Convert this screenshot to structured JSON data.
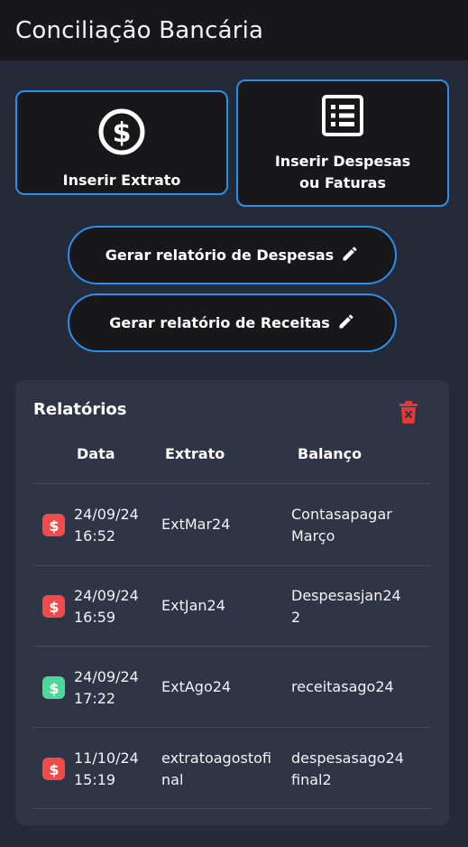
{
  "header": {
    "title": "Conciliação Bancária"
  },
  "actions": {
    "extrato_label": "Inserir Extrato",
    "despesas_label": "Inserir Despesas\nou Faturas",
    "relatorio_despesas_label": "Gerar relatório de Despesas",
    "relatorio_receitas_label": "Gerar relatório de Receitas"
  },
  "reports": {
    "title": "Relatórios",
    "columns": {
      "data": "Data",
      "extrato": "Extrato",
      "balanco": "Balanço"
    },
    "rows": [
      {
        "status": "expense",
        "status_color": "#f04a4a",
        "date": "24/09/24\n16:52",
        "extrato": "ExtMar24",
        "balanco": "Contasapagar\nMarço"
      },
      {
        "status": "expense",
        "status_color": "#f04a4a",
        "date": "24/09/24\n16:59",
        "extrato": "ExtJan24",
        "balanco": "Despesasjan24\n2"
      },
      {
        "status": "income",
        "status_color": "#4ed79a",
        "date": "24/09/24\n17:22",
        "extrato": "ExtAgo24",
        "balanco": "receitasago24"
      },
      {
        "status": "expense",
        "status_color": "#f04a4a",
        "date": "11/10/24\n15:19",
        "extrato": "extratoagostofi\nnal",
        "balanco": "despesasago24\nfinal2"
      }
    ]
  },
  "colors": {
    "accent": "#2b8fea",
    "danger": "#e53935",
    "income": "#4ed79a",
    "expense": "#f04a4a"
  },
  "icons": {
    "extrato": "dollar-circle-icon",
    "despesas": "list-document-icon",
    "pencil": "pencil-icon",
    "delete": "trash-icon",
    "status": "dollar-icon"
  }
}
